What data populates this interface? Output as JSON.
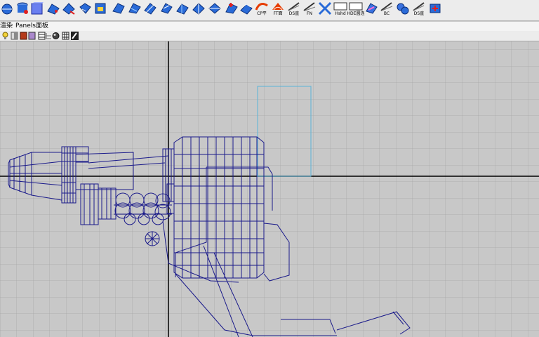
{
  "toolbar": {
    "labels": {
      "cp_label": "CP平",
      "ft_label": "FT面",
      "ds_label": "DS直",
      "fn_label": "FN",
      "hshd_label": "Hshd",
      "hde_label": "HDE圆连",
      "bc_label": "BC",
      "ds2_label": "DS直"
    }
  },
  "menubar": {
    "render_label": "渲染",
    "panels_label": "Panels面板"
  },
  "colors": {
    "wireframe": "#1a1a8a",
    "selection": "#5ab3d8",
    "grid_minor": "#aaaaaa",
    "axis": "#000000",
    "viewport_bg": "#c8c8c8"
  }
}
